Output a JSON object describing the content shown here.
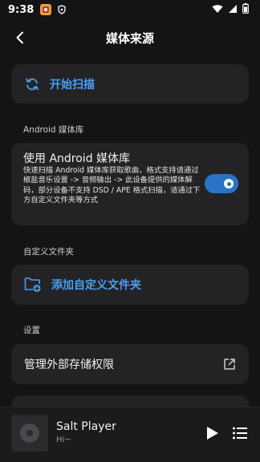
{
  "status_bar": {
    "time": "9:38",
    "icons": [
      "app-notification-icon",
      "shield-icon",
      "wifi-icon",
      "cellular-signal-icon",
      "battery-icon"
    ]
  },
  "app_bar": {
    "title": "媒体来源",
    "back_icon": "back-arrow-icon"
  },
  "scan": {
    "label": "开始扫描",
    "icon": "refresh-icon"
  },
  "android_section": {
    "header": "Android 媒体库",
    "toggle_title": "使用 Android 媒体库",
    "toggle_desc": "快速扫描 Android 媒体库获取歌曲，格式支持请通过椒盐音乐设置 -> 音频输出 -> 此设备提供的媒体解码，部分设备不支持 DSD / APE 格式扫描，请通过下方自定义文件夹等方式",
    "toggle_on": true
  },
  "custom_section": {
    "header": "自定义文件夹",
    "add_label": "添加自定义文件夹",
    "icon": "folder-add-icon"
  },
  "settings_section": {
    "header": "设置",
    "manage_label": "管理外部存储权限",
    "icon": "open-external-icon"
  },
  "player": {
    "title": "Salt Player",
    "subtitle": "Hi~",
    "play_icon": "play-icon",
    "queue_icon": "queue-list-icon"
  },
  "colors": {
    "background": "#141416",
    "card": "#232326",
    "accent": "#4a9ff5",
    "toggle": "#2a73c6"
  }
}
